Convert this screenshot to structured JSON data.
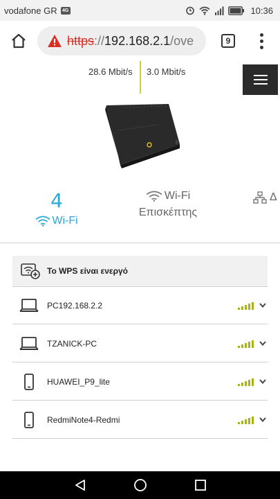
{
  "status_bar": {
    "carrier": "vodafone GR",
    "carrier_tag": "4G",
    "time": "10:36"
  },
  "browser": {
    "url_scheme": "https",
    "url_separator": "://",
    "url_host": "192.168.2.1",
    "url_path": "/ove",
    "tab_count": "9"
  },
  "speeds": {
    "download": "28.6 Mbit/s",
    "upload": "3.0 Mbit/s"
  },
  "stats": {
    "wifi_count": "4",
    "wifi_label": "Wi-Fi",
    "guest_label_line1": "Wi-Fi",
    "guest_label_line2": "Επισκέπτης",
    "lan_label": "Δ"
  },
  "wps": {
    "label": "Το WPS είναι ενεργό"
  },
  "devices": [
    {
      "name": "PC192.168.2.2",
      "type": "laptop-icon"
    },
    {
      "name": "TZANICK-PC",
      "type": "laptop-icon"
    },
    {
      "name": "HUAWEI_P9_lite",
      "type": "phone-icon"
    },
    {
      "name": "RedmiNote4-Redmi",
      "type": "phone-icon"
    }
  ],
  "colors": {
    "accent_blue": "#2aa8d8",
    "signal_green": "#a6b418",
    "url_warning_red": "#d93025",
    "speed_divider": "#c8d43a"
  }
}
